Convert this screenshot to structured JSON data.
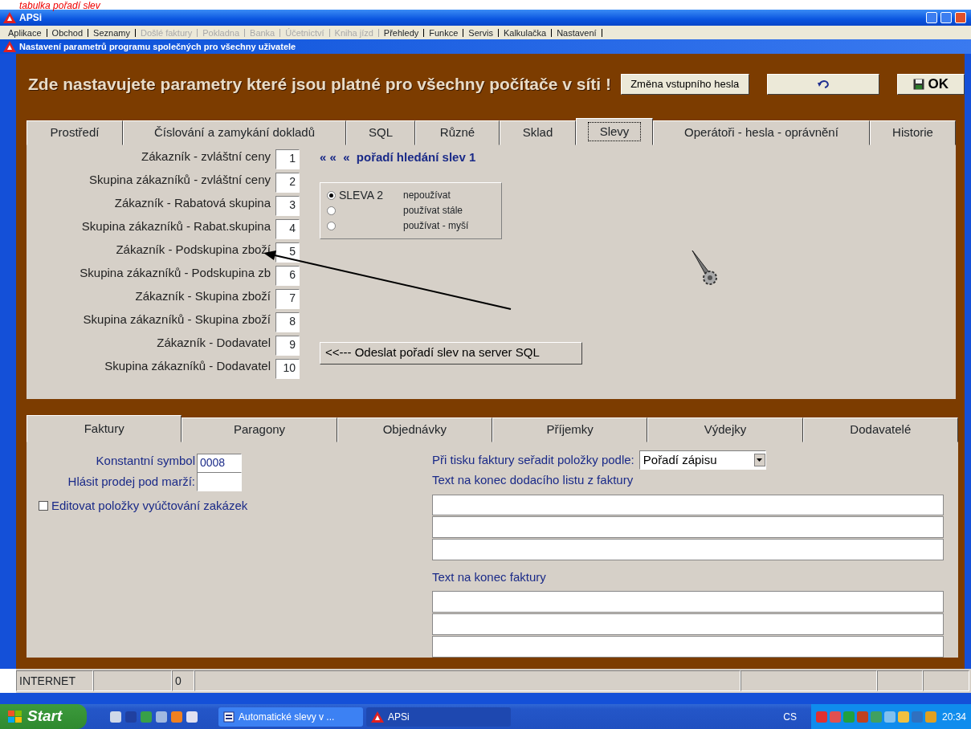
{
  "annotation": {
    "text": "tabulka pořadí slev"
  },
  "window": {
    "title": "APSi"
  },
  "menu": [
    {
      "label": "Aplikace",
      "disabled": false
    },
    {
      "label": "Obchod",
      "disabled": false
    },
    {
      "label": "Seznamy",
      "disabled": false
    },
    {
      "label": "Došlé faktury",
      "disabled": true
    },
    {
      "label": "Pokladna",
      "disabled": true
    },
    {
      "label": "Banka",
      "disabled": true
    },
    {
      "label": "Účetnictví",
      "disabled": true
    },
    {
      "label": "Kniha jízd",
      "disabled": true
    },
    {
      "label": "Přehledy",
      "disabled": false
    },
    {
      "label": "Funkce",
      "disabled": false
    },
    {
      "label": "Servis",
      "disabled": false
    },
    {
      "label": "Kalkulačka",
      "disabled": false
    },
    {
      "label": "Nastavení",
      "disabled": false
    }
  ],
  "dialog": {
    "title": "Nastavení parametrů programu společných pro všechny uživatele",
    "heading": "Zde nastavujete parametry které jsou platné pro všechny počítače v síti !",
    "buttons": [
      {
        "kind": "text",
        "label": "Změna vstupního hesla"
      },
      {
        "kind": "undo"
      },
      {
        "kind": "save",
        "label": "OK"
      }
    ]
  },
  "tabs": [
    {
      "label": "Prostředí",
      "selected": false
    },
    {
      "label": "Číslování a zamykání dokladů",
      "selected": false
    },
    {
      "label": "SQL",
      "selected": false
    },
    {
      "label": "Různé",
      "selected": false
    },
    {
      "label": "Sklad",
      "selected": false
    },
    {
      "label": "Slevy",
      "selected": true
    },
    {
      "label": "Operátoři - hesla - oprávnění",
      "selected": false
    },
    {
      "label": "Historie",
      "selected": false
    }
  ],
  "discount_order": {
    "rows": [
      {
        "label": "Zákazník - zvláštní ceny",
        "value": "1"
      },
      {
        "label": "Skupina zákazníků - zvláštní ceny",
        "value": "2"
      },
      {
        "label": "Zákazník - Rabatová skupina",
        "value": "3"
      },
      {
        "label": "Skupina zákazníků - Rabat.skupina",
        "value": "4"
      },
      {
        "label": "Zákazník - Podskupina zboží",
        "value": "5"
      },
      {
        "label": "Skupina zákazníků - Podskupina zb",
        "value": "6"
      },
      {
        "label": "Zákazník - Skupina zboží",
        "value": "7"
      },
      {
        "label": "Skupina zákazníků - Skupina zboží",
        "value": "8"
      },
      {
        "label": "Zákazník - Dodavatel",
        "value": "9"
      },
      {
        "label": "Skupina zákazníků - Dodavatel",
        "value": "10"
      }
    ],
    "title": "« «  «  pořadí hledání slev 1",
    "sleva2": {
      "label": "SLEVA 2",
      "options": [
        {
          "label": "nepoužívat",
          "selected": true
        },
        {
          "label": "používat stále",
          "selected": false
        },
        {
          "label": "používat - myší",
          "selected": false
        }
      ]
    },
    "send_button": "<<--- Odeslat pořadí slev na server SQL"
  },
  "lower_tabs": [
    {
      "label": "Faktury",
      "selected": true
    },
    {
      "label": "Paragony",
      "selected": false
    },
    {
      "label": "Objednávky",
      "selected": false
    },
    {
      "label": "Příjemky",
      "selected": false
    },
    {
      "label": "Výdejky",
      "selected": false
    },
    {
      "label": "Dodavatelé",
      "selected": false
    }
  ],
  "invoice": {
    "constant_symbol": {
      "label": "Konstantní symbol",
      "value": "0008"
    },
    "margin_warning": {
      "label": "Hlásit prodej pod marží:"
    },
    "edit_items": {
      "label": "Editovat  položky vyúčtování zakázek",
      "checked": false
    },
    "sort": {
      "label": "Při tisku faktury seřadit položky podle:",
      "value": "Pořadí zápisu"
    },
    "delivery_note_text": {
      "label": "Text na konec dodacího listu z faktury"
    },
    "invoice_text": {
      "label": "Text na konec faktury"
    }
  },
  "status_bar": [
    "INTERNET",
    "0"
  ],
  "taskbar": {
    "start": "Start",
    "tasks": [
      {
        "label": "Automatické slevy v ...",
        "kind": "document",
        "selected": false
      },
      {
        "label": "APSi",
        "kind": "app",
        "selected": true
      }
    ],
    "language": "CS",
    "clock": "20:34"
  }
}
